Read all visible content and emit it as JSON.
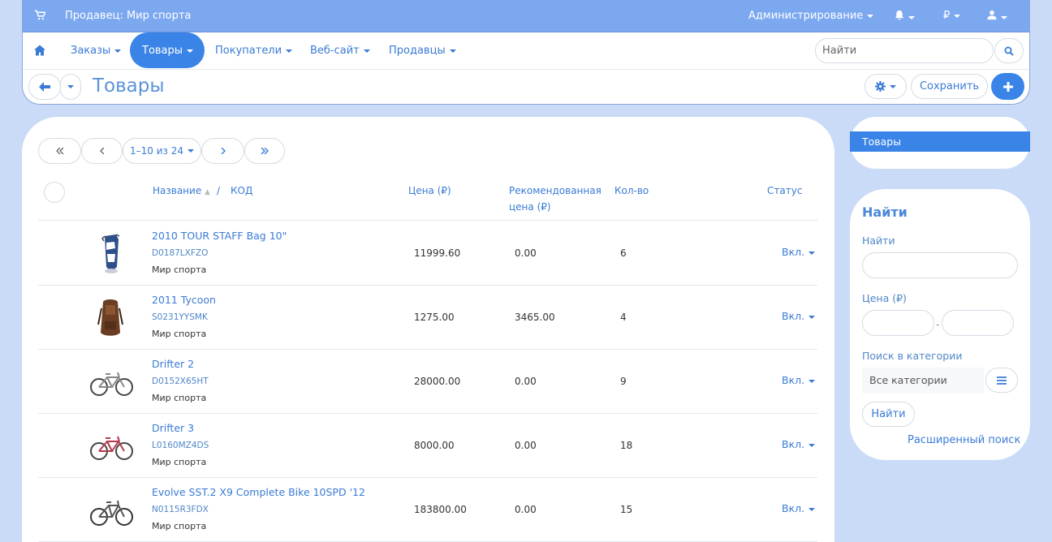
{
  "topbar": {
    "vendor": "Продавец: Мир спорта",
    "admin": "Администрирование",
    "currency": "₽"
  },
  "nav": {
    "items": [
      "Заказы",
      "Товары",
      "Покупатели",
      "Веб-сайт",
      "Продавцы"
    ],
    "active": "Товары",
    "search_placeholder": "Найти"
  },
  "page": {
    "title": "Товары",
    "save_label": "Сохранить"
  },
  "pager": {
    "range": "1–10 из 24"
  },
  "table": {
    "headers": {
      "name": "Название",
      "sep": "/",
      "code": "КОД",
      "price": "Цена (₽)",
      "rec_price_1": "Рекомендованная",
      "rec_price_2": "цена (₽)",
      "qty": "Кол-во",
      "status": "Статус"
    },
    "rows": [
      {
        "name": "2010 TOUR STAFF Bag 10\"",
        "code": "D0187LXFZO",
        "vendor": "Мир спорта",
        "price": "11999.60",
        "rec_price": "0.00",
        "qty": "6",
        "status": "Вкл.",
        "icon": "golf-bag-icon"
      },
      {
        "name": "2011 Tycoon",
        "code": "S0231YYSMK",
        "vendor": "Мир спорта",
        "price": "1275.00",
        "rec_price": "3465.00",
        "qty": "4",
        "status": "Вкл.",
        "icon": "backpack-icon"
      },
      {
        "name": "Drifter 2",
        "code": "D0152X65HT",
        "vendor": "Мир спорта",
        "price": "28000.00",
        "rec_price": "0.00",
        "qty": "9",
        "status": "Вкл.",
        "icon": "bicycle-icon"
      },
      {
        "name": "Drifter 3",
        "code": "L0160MZ4DS",
        "vendor": "Мир спорта",
        "price": "8000.00",
        "rec_price": "0.00",
        "qty": "18",
        "status": "Вкл.",
        "icon": "bicycle-icon"
      },
      {
        "name": "Evolve SST.2 X9 Complete Bike 10SPD '12",
        "code": "N0115R3FDX",
        "vendor": "Мир спорта",
        "price": "183800.00",
        "rec_price": "0.00",
        "qty": "15",
        "status": "Вкл.",
        "icon": "bicycle-icon"
      }
    ]
  },
  "sidebar": {
    "active_item": "Товары",
    "search": {
      "title": "Найти",
      "find_label": "Найти",
      "price_label": "Цена (₽)",
      "dash": "-",
      "category_label": "Поиск в категории",
      "category_value": "Все категории",
      "find_button": "Найти",
      "advanced": "Расширенный поиск"
    }
  },
  "colors": {
    "accent": "#3a84e8",
    "topbar": "#7ca8f0",
    "background": "#c9dbf7"
  }
}
